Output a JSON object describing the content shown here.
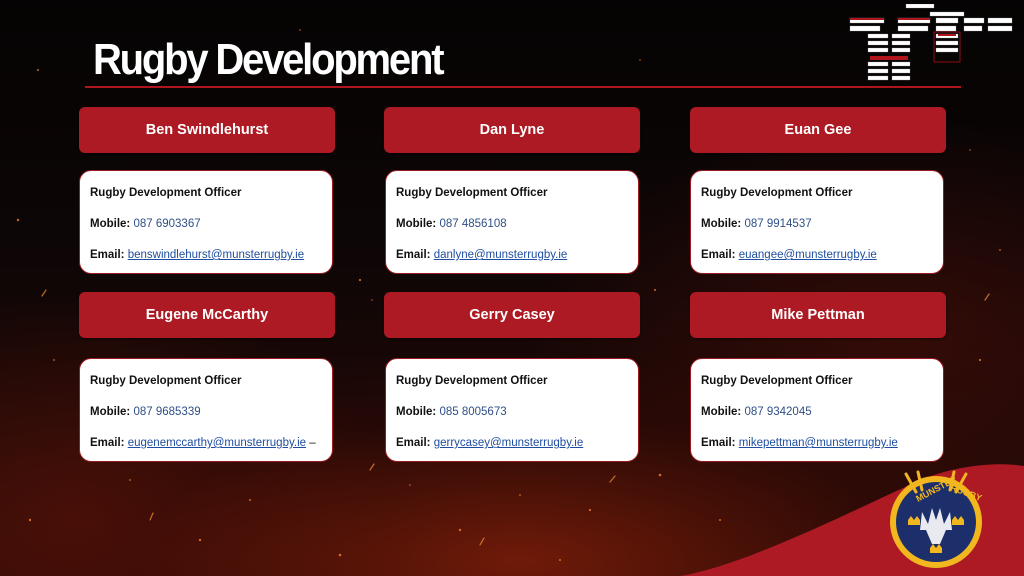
{
  "page": {
    "title": "Rugby Development"
  },
  "contacts": [
    {
      "name": "Ben Swindlehurst",
      "role": "Rugby Development Officer",
      "mobile_label": "Mobile:",
      "mobile": "087 6903367",
      "email_label": "Email:",
      "email": "benswindlehurst@munsterrugby.ie",
      "email_suffix": ""
    },
    {
      "name": "Dan Lyne",
      "role": "Rugby Development Officer",
      "mobile_label": "Mobile:",
      "mobile": "087 4856108",
      "email_label": "Email:",
      "email": "danlyne@munsterrugby.ie",
      "email_suffix": ""
    },
    {
      "name": "Euan Gee",
      "role": "Rugby Development Officer",
      "mobile_label": "Mobile:",
      "mobile": "087 9914537",
      "email_label": "Email:",
      "email": "euangee@munsterrugby.ie",
      "email_suffix": ""
    },
    {
      "name": "Eugene McCarthy",
      "role": "Rugby Development Officer",
      "mobile_label": "Mobile:",
      "mobile": "087 9685339",
      "email_label": "Email:",
      "email": "eugenemccarthy@munsterrugby.ie",
      "email_suffix": " –"
    },
    {
      "name": "Gerry Casey",
      "role": "Rugby Development Officer",
      "mobile_label": "Mobile:",
      "mobile": "085 8005673",
      "email_label": "Email:",
      "email": "gerrycasey@munsterrugby.ie",
      "email_suffix": ""
    },
    {
      "name": "Mike Pettman",
      "role": "Rugby Development Officer",
      "mobile_label": "Mobile:",
      "mobile": "087 9342045",
      "email_label": "Email:",
      "email": "mikepettman@munsterrugby.ie",
      "email_suffix": ""
    }
  ],
  "logo": {
    "text_left": "MUNSTER",
    "text_right": "RUGBY"
  },
  "colors": {
    "brand_red": "#ad1a23",
    "link_blue": "#1f4ea1",
    "crest_navy": "#1c2f6b",
    "crest_gold": "#f2b61f"
  },
  "icons": [
    "org-chart-thumbnail-icon",
    "munster-crest-icon"
  ]
}
